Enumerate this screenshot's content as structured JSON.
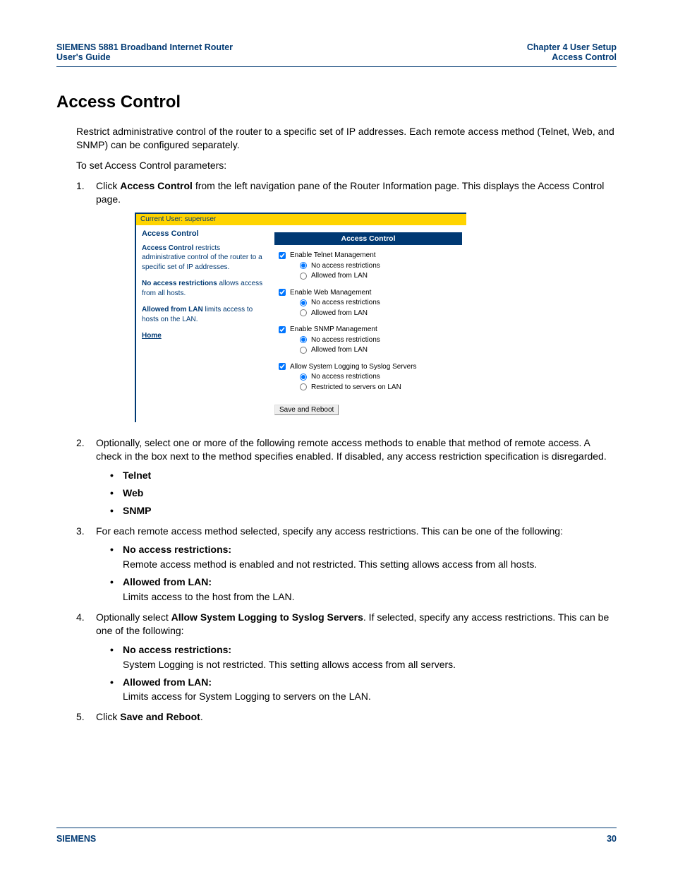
{
  "header": {
    "left_line1": "SIEMENS 5881 Broadband Internet Router",
    "left_line2": "User's Guide",
    "right_line1": "Chapter 4  User Setup",
    "right_line2": "Access Control"
  },
  "title": "Access Control",
  "intro1": "Restrict administrative control of the router to a specific set of IP addresses. Each remote access method (Telnet, Web, and SNMP) can be configured separately.",
  "intro2": "To set Access Control parameters:",
  "steps": {
    "s1_pre": "Click ",
    "s1_bold": "Access Control",
    "s1_post": " from the left navigation pane of the Router Information page. This displays the Access Control page.",
    "s2": "Optionally, select one or more of the following remote access methods to enable that method of remote access. A check in the box next to the method specifies enabled. If disabled, any access restriction specification is disregarded.",
    "s2_items": [
      "Telnet",
      "Web",
      "SNMP"
    ],
    "s3": "For each remote access method selected, specify any access restrictions. This can be one of the following:",
    "s3_items": [
      {
        "label": "No access restrictions:",
        "desc": "Remote access method is enabled and not restricted. This setting allows access from all hosts."
      },
      {
        "label": "Allowed from LAN:",
        "desc": "Limits access to the host from the LAN."
      }
    ],
    "s4_pre": "Optionally select ",
    "s4_bold": "Allow System Logging to Syslog Servers",
    "s4_post": ". If selected, specify any access restrictions. This can be one of the following:",
    "s4_items": [
      {
        "label": "No access restrictions:",
        "desc": "System Logging is not restricted. This setting allows access from all servers."
      },
      {
        "label": "Allowed from LAN:",
        "desc": "Limits access for System Logging to servers on the LAN."
      }
    ],
    "s5_pre": "Click ",
    "s5_bold": "Save and Reboot",
    "s5_post": "."
  },
  "shot": {
    "current_user": "Current User: superuser",
    "left_heading": "Access Control",
    "p1_b": "Access Control",
    "p1_r": " restricts administrative control of the router to a specific set of IP addresses.",
    "p2_b": "No access restrictions",
    "p2_r": " allows access from all hosts.",
    "p3_b": "Allowed from LAN",
    "p3_r": " limits access to hosts on the LAN.",
    "home": "Home",
    "panel_title": "Access Control",
    "g1": {
      "cb": "Enable Telnet Management",
      "r1": "No access restrictions",
      "r2": "Allowed from LAN"
    },
    "g2": {
      "cb": "Enable Web Management",
      "r1": "No access restrictions",
      "r2": "Allowed from LAN"
    },
    "g3": {
      "cb": "Enable SNMP Management",
      "r1": "No access restrictions",
      "r2": "Allowed from LAN"
    },
    "g4": {
      "cb": "Allow System Logging to Syslog Servers",
      "r1": "No access restrictions",
      "r2": "Restricted to servers on LAN"
    },
    "button": "Save and Reboot"
  },
  "footer": {
    "brand": "SIEMENS",
    "page": "30"
  }
}
